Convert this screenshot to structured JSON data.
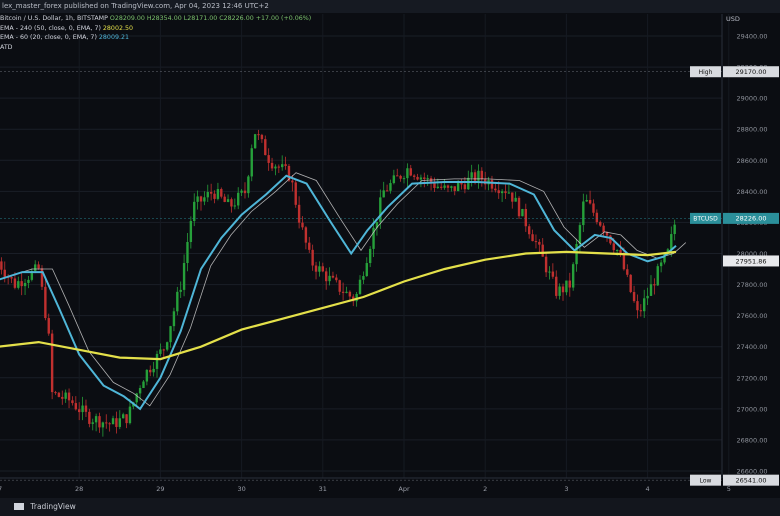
{
  "header": {
    "publisher_line": "lex_master_forex published on TradingView.com, Apr 04, 2023 12:46 UTC+2"
  },
  "legend": {
    "symbol": "Bitcoin / U.S. Dollar, 1h, BITSTAMP",
    "ohlc": "O28209.00 H28354.00 L28171.00 C28226.00 +17.00 (+0.06%)",
    "ema240": "EMA - 240 (50, close, 0, EMA, 7)",
    "ema240_value": "28002.50",
    "ema60": "EMA - 60 (20, close, 0, EMA, 7)",
    "ema60_value": "28009.21",
    "atr": "ATD"
  },
  "footer": {
    "brand": "TradingView"
  },
  "colors": {
    "background": "#0b0d12",
    "up": "#26a03a",
    "down": "#c0302f",
    "ema240": "#e4e04a",
    "ema60": "#4fb6d8",
    "ema_thin": "#d9d9d9"
  },
  "chart_data": {
    "type": "candlestick",
    "currency_label": "USD",
    "y_ticks": [
      "29400.00",
      "29200.00",
      "29000.00",
      "28800.00",
      "28600.00",
      "28400.00",
      "28200.00",
      "28000.00",
      "27800.00",
      "27600.00",
      "27400.00",
      "27200.00",
      "27000.00",
      "26800.00",
      "26600.00"
    ],
    "x_ticks": [
      "27",
      "28",
      "29",
      "30",
      "31",
      "Apr",
      "2",
      "3",
      "4",
      "5"
    ],
    "markers": [
      {
        "label": "High",
        "value": "29170.00",
        "price": 29170
      },
      {
        "label": "BTCUSD",
        "value": "28226.00",
        "price": 28226
      },
      {
        "label": "",
        "value": "27951.86",
        "price": 27952
      },
      {
        "label": "Low",
        "value": "26541.00",
        "price": 26541
      }
    ],
    "anchors": [
      {
        "day": 0.0,
        "p": 27950
      },
      {
        "day": 0.2,
        "p": 27800
      },
      {
        "day": 0.5,
        "p": 27900
      },
      {
        "day": 0.62,
        "p": 27500
      },
      {
        "day": 0.66,
        "p": 27100
      },
      {
        "day": 0.9,
        "p": 27050
      },
      {
        "day": 1.1,
        "p": 26950
      },
      {
        "day": 1.4,
        "p": 26900
      },
      {
        "day": 1.6,
        "p": 26950
      },
      {
        "day": 1.78,
        "p": 27200
      },
      {
        "day": 2.05,
        "p": 27400
      },
      {
        "day": 2.25,
        "p": 27800
      },
      {
        "day": 2.4,
        "p": 28300
      },
      {
        "day": 2.65,
        "p": 28400
      },
      {
        "day": 2.85,
        "p": 28300
      },
      {
        "day": 3.05,
        "p": 28400
      },
      {
        "day": 3.15,
        "p": 28800
      },
      {
        "day": 3.35,
        "p": 28600
      },
      {
        "day": 3.6,
        "p": 28500
      },
      {
        "day": 3.72,
        "p": 28200
      },
      {
        "day": 3.85,
        "p": 27950
      },
      {
        "day": 4.15,
        "p": 27800
      },
      {
        "day": 4.4,
        "p": 27700
      },
      {
        "day": 4.55,
        "p": 28000
      },
      {
        "day": 4.75,
        "p": 28400
      },
      {
        "day": 5.05,
        "p": 28550
      },
      {
        "day": 5.35,
        "p": 28450
      },
      {
        "day": 5.55,
        "p": 28400
      },
      {
        "day": 5.9,
        "p": 28500
      },
      {
        "day": 6.3,
        "p": 28400
      },
      {
        "day": 6.6,
        "p": 28100
      },
      {
        "day": 6.88,
        "p": 27750
      },
      {
        "day": 7.05,
        "p": 27800
      },
      {
        "day": 7.22,
        "p": 28350
      },
      {
        "day": 7.42,
        "p": 28200
      },
      {
        "day": 7.65,
        "p": 28000
      },
      {
        "day": 7.88,
        "p": 27600
      },
      {
        "day": 8.1,
        "p": 27850
      },
      {
        "day": 8.25,
        "p": 28000
      },
      {
        "day": 8.35,
        "p": 28226
      }
    ],
    "ema240_curve": [
      {
        "day": 0.0,
        "p": 27400
      },
      {
        "day": 0.5,
        "p": 27430
      },
      {
        "day": 1.0,
        "p": 27380
      },
      {
        "day": 1.5,
        "p": 27330
      },
      {
        "day": 2.0,
        "p": 27320
      },
      {
        "day": 2.5,
        "p": 27400
      },
      {
        "day": 3.0,
        "p": 27510
      },
      {
        "day": 3.5,
        "p": 27580
      },
      {
        "day": 4.0,
        "p": 27650
      },
      {
        "day": 4.5,
        "p": 27720
      },
      {
        "day": 5.0,
        "p": 27820
      },
      {
        "day": 5.5,
        "p": 27900
      },
      {
        "day": 6.0,
        "p": 27960
      },
      {
        "day": 6.5,
        "p": 28000
      },
      {
        "day": 7.0,
        "p": 28010
      },
      {
        "day": 7.5,
        "p": 28000
      },
      {
        "day": 8.0,
        "p": 27990
      },
      {
        "day": 8.35,
        "p": 28010
      }
    ],
    "ema60_curve": [
      {
        "day": 0.0,
        "p": 27830
      },
      {
        "day": 0.3,
        "p": 27880
      },
      {
        "day": 0.55,
        "p": 27880
      },
      {
        "day": 0.75,
        "p": 27650
      },
      {
        "day": 1.0,
        "p": 27350
      },
      {
        "day": 1.3,
        "p": 27150
      },
      {
        "day": 1.55,
        "p": 27080
      },
      {
        "day": 1.75,
        "p": 27000
      },
      {
        "day": 2.0,
        "p": 27200
      },
      {
        "day": 2.25,
        "p": 27500
      },
      {
        "day": 2.5,
        "p": 27900
      },
      {
        "day": 2.75,
        "p": 28100
      },
      {
        "day": 3.0,
        "p": 28250
      },
      {
        "day": 3.3,
        "p": 28380
      },
      {
        "day": 3.55,
        "p": 28500
      },
      {
        "day": 3.8,
        "p": 28450
      },
      {
        "day": 4.1,
        "p": 28200
      },
      {
        "day": 4.35,
        "p": 28000
      },
      {
        "day": 4.55,
        "p": 28150
      },
      {
        "day": 4.8,
        "p": 28300
      },
      {
        "day": 5.1,
        "p": 28450
      },
      {
        "day": 5.5,
        "p": 28460
      },
      {
        "day": 5.9,
        "p": 28460
      },
      {
        "day": 6.3,
        "p": 28450
      },
      {
        "day": 6.6,
        "p": 28380
      },
      {
        "day": 6.85,
        "p": 28150
      },
      {
        "day": 7.1,
        "p": 28020
      },
      {
        "day": 7.35,
        "p": 28120
      },
      {
        "day": 7.55,
        "p": 28100
      },
      {
        "day": 7.75,
        "p": 28000
      },
      {
        "day": 8.0,
        "p": 27950
      },
      {
        "day": 8.2,
        "p": 27980
      },
      {
        "day": 8.35,
        "p": 28050
      }
    ]
  }
}
